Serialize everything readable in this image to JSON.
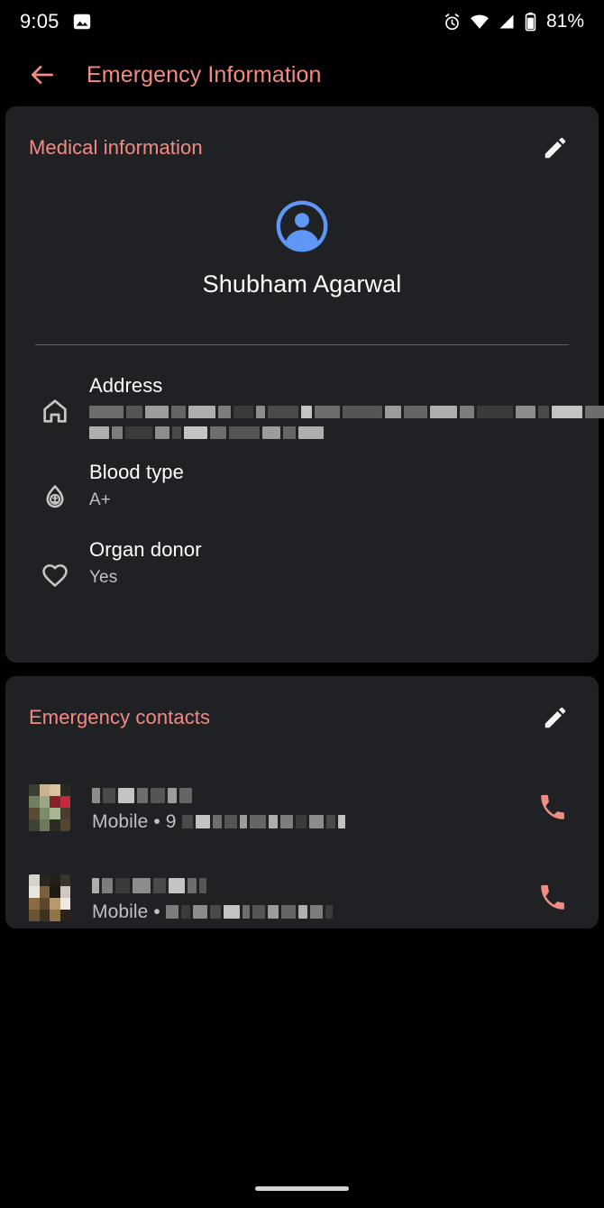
{
  "status_bar": {
    "clock": "9:05",
    "battery_percent": "81%",
    "icons": [
      "photo-notification-icon",
      "alarm-icon",
      "wifi-icon",
      "cellular-signal-icon",
      "battery-icon"
    ]
  },
  "app_bar": {
    "back_label": "back-arrow",
    "title": "Emergency Information",
    "accent_color": "#f28b82"
  },
  "medical_card": {
    "title": "Medical information",
    "edit_label": "edit",
    "profile": {
      "name": "Shubham Agarwal",
      "avatar_color": "#5e97f6"
    },
    "rows": [
      {
        "icon": "home-icon",
        "label": "Address",
        "value": "",
        "redacted": true,
        "redact_lines": [
          [
            38,
            18,
            26,
            16,
            30,
            14,
            22,
            10,
            34,
            12,
            28,
            44,
            18,
            26,
            30,
            16,
            40,
            22,
            12,
            34,
            26,
            18,
            30,
            14,
            38,
            20,
            26,
            32,
            16,
            24,
            38,
            14,
            30,
            20,
            26,
            16,
            36,
            22,
            18,
            30,
            24
          ],
          [
            22,
            12,
            30,
            16,
            10,
            26,
            18,
            34,
            20,
            14,
            28
          ]
        ]
      },
      {
        "icon": "blood-drop-icon",
        "label": "Blood type",
        "value": "A+",
        "redacted": false
      },
      {
        "icon": "heart-icon",
        "label": "Organ donor",
        "value": "Yes",
        "redacted": false
      }
    ]
  },
  "contacts_card": {
    "title": "Emergency contacts",
    "edit_label": "edit",
    "contacts": [
      {
        "name": "",
        "name_redacted": true,
        "name_blocks": [
          9,
          14,
          18,
          12,
          16,
          10,
          14
        ],
        "subtitle_prefix": "Mobile • ",
        "number_visible": "9",
        "number_blocks": [
          12,
          16,
          10,
          14,
          8,
          18,
          10,
          14,
          12,
          16,
          10,
          8
        ],
        "photo_colors": [
          "#3a4032",
          "#c9b391",
          "#d8c3a0",
          "#2a2a24",
          "#6f8060",
          "#97a788",
          "#8a1f2e",
          "#c32b3c",
          "#5a4a34",
          "#7d8c6d",
          "#a7b594",
          "#4a3b2c",
          "#3c4434",
          "#6b7a5b",
          "#2f2a22",
          "#55452f"
        ],
        "call_label": "call"
      },
      {
        "name": "",
        "name_redacted": true,
        "name_blocks": [
          8,
          12,
          16,
          20,
          14,
          18,
          10,
          8
        ],
        "subtitle_prefix": "Mobile • ",
        "number_visible": "",
        "number_blocks": [
          14,
          10,
          16,
          12,
          18,
          8,
          14,
          12,
          16,
          10,
          14,
          8
        ],
        "photo_colors": [
          "#d7d3cb",
          "#2a2520",
          "#23201b",
          "#3a342b",
          "#e8e6e1",
          "#7a5f3c",
          "#1d1a16",
          "#cfc8bb",
          "#8a6b42",
          "#5e4728",
          "#b79a6c",
          "#ece9e3",
          "#6b5434",
          "#3f3122",
          "#8f7448",
          "#2b2219"
        ],
        "call_label": "call"
      }
    ],
    "accent_color": "#f28b82"
  },
  "nav_bar": {
    "home_indicator": "home-pill"
  }
}
